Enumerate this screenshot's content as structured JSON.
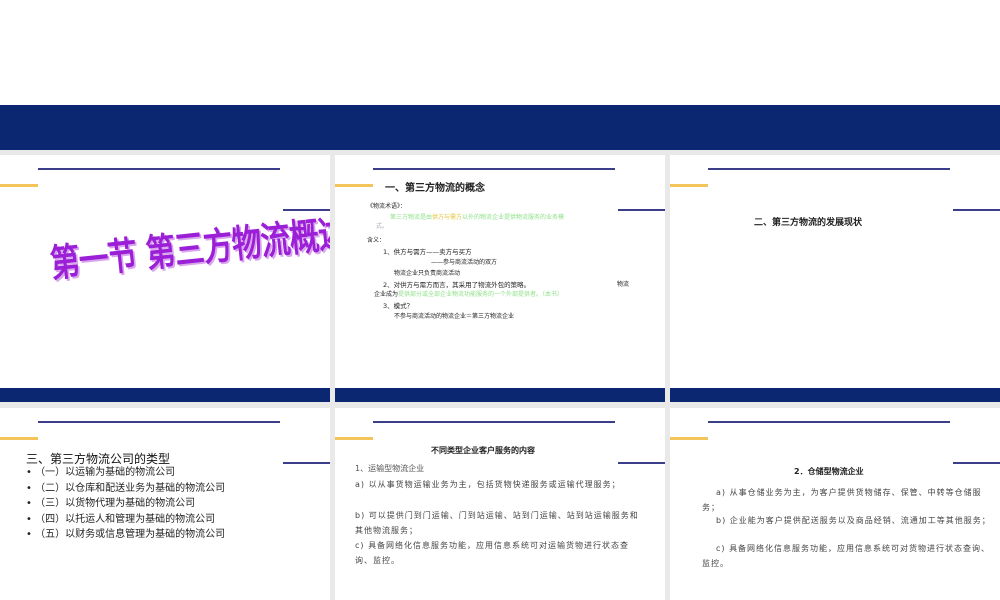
{
  "slides": [
    {
      "title": "第一节 第三方物流概述"
    },
    {
      "title": "一、第三方物流的概念",
      "term_label": "《物流术语》：",
      "def_a": "第三方物流是由",
      "def_b": "供方与需方",
      "def_c": "以外的物流企业提供物流服务的业务模",
      "def_d": "式。",
      "meaning": "含义：",
      "l1": "1、供方与需方——卖方与买方",
      "l2": "——参与商流活动的双方",
      "l3": "物流企业只负责商流活动",
      "l4": "2、对供方与需方而言，其采用了物流外包的策略。",
      "l4b": "物流",
      "l5a": "企业成为",
      "l5b": "提供部分或全部企业物流功能服务的一个外部提供者。（本书）",
      "l6": "3、模式？",
      "l7": "不参与商流活动的物流企业＝第三方物流企业"
    },
    {
      "title": "二、第三方物流的发展现状"
    },
    {
      "title": "三、第三方物流公司的类型",
      "items": [
        "（一）以运输为基础的物流公司",
        "（二）以仓库和配送业务为基础的物流公司",
        "（三）以货物代理为基础的物流公司",
        "（四）以托运人和管理为基础的物流公司",
        "（五）以财务或信息管理为基础的物流公司"
      ]
    },
    {
      "title": "不同类型企业客户服务的内容",
      "heading": "1、运输型物流企业",
      "paras": [
        "a) 以从事货物运输业务为主，包括货物快递服务或运输代理服务；",
        "b) 可以提供门到门运输、门到站运输、站到门运输、站到站运输服务和其他物流服务；",
        "c) 具备网络化信息服务功能，应用信息系统可对运输货物进行状态查询、监控。"
      ]
    },
    {
      "title": "2．仓储型物流企业",
      "paras": [
        "a) 从事仓储业务为主，为客户提供货物储存、保管、中转等仓储服务；",
        "b) 企业能为客户提供配送服务以及商品经销、流通加工等其他服务；",
        "c) 具备网络化信息服务功能，应用信息系统可对货物进行状态查询、监控。"
      ]
    }
  ]
}
